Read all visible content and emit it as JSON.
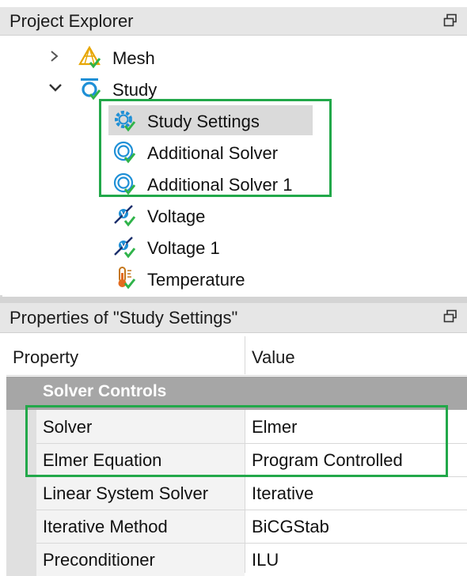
{
  "explorer": {
    "title": "Project Explorer",
    "items": [
      {
        "label": "Mesh",
        "icon": "mesh-icon",
        "expanded": false
      },
      {
        "label": "Study",
        "icon": "study-icon",
        "expanded": true
      },
      {
        "label": "Study Settings",
        "icon": "study-settings-icon",
        "selected": true
      },
      {
        "label": "Additional Solver",
        "icon": "solver-icon"
      },
      {
        "label": "Additional Solver 1",
        "icon": "solver-icon"
      },
      {
        "label": "Voltage",
        "icon": "voltage-icon"
      },
      {
        "label": "Voltage 1",
        "icon": "voltage-icon"
      },
      {
        "label": "Temperature",
        "icon": "temperature-icon"
      }
    ]
  },
  "properties": {
    "title": "Properties of \"Study Settings\"",
    "columns": {
      "property": "Property",
      "value": "Value"
    },
    "group": "Solver Controls",
    "rows": [
      {
        "name": "Solver",
        "value": "Elmer"
      },
      {
        "name": "Elmer Equation",
        "value": "Program Controlled"
      },
      {
        "name": "Linear System Solver",
        "value": "Iterative"
      },
      {
        "name": "Iterative Method",
        "value": "BiCGStab"
      },
      {
        "name": "Preconditioner",
        "value": "ILU"
      }
    ]
  },
  "colors": {
    "highlight": "#22a84a",
    "selection": "#dadada",
    "group_header": "#a6a6a6",
    "icon_blue": "#1e8fd6",
    "check_green": "#2fb34a"
  }
}
